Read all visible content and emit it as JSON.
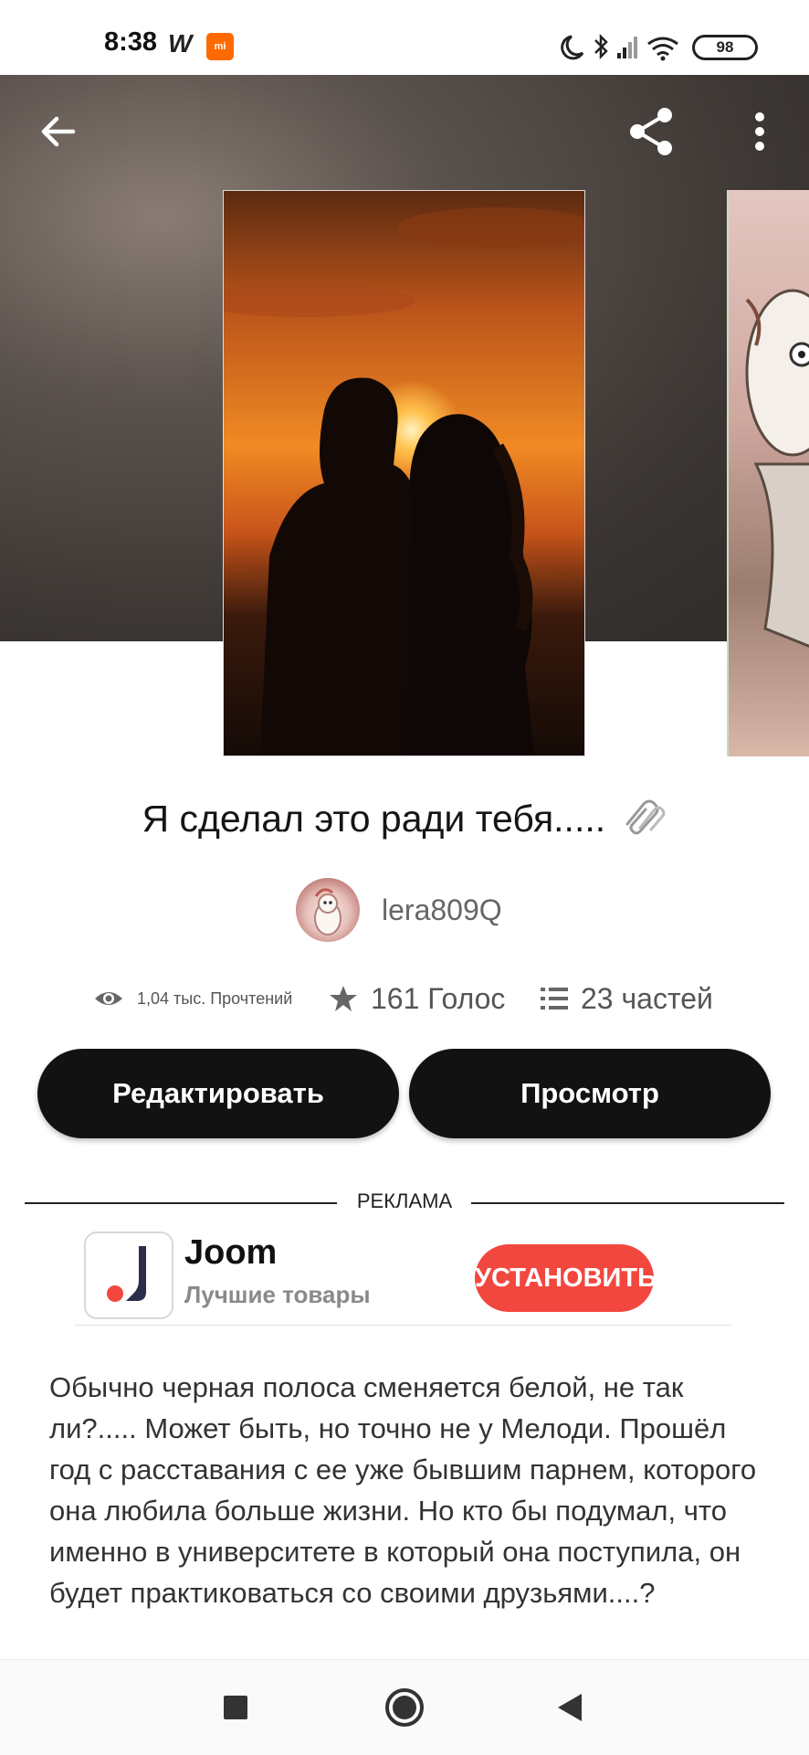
{
  "status_bar": {
    "time": "8:38",
    "app_badge": "W",
    "mi_badge": "mi",
    "battery": "98"
  },
  "story": {
    "title": "Я сделал это ради тебя.....",
    "author": "lera809Q",
    "reads": "1,04 тыс. Прочтений",
    "votes": "161 Голос",
    "parts": "23 частей"
  },
  "actions": {
    "edit_label": "Редактировать",
    "view_label": "Просмотр"
  },
  "ad": {
    "label": "РЕКЛАМА",
    "app_name": "Joom",
    "app_tagline": "Лучшие товары",
    "install_label": "УСТАНОВИТЬ",
    "accent_color": "#f2473f"
  },
  "description": "Обычно черная полоса сменяется белой, не так ли?..... Может быть, но точно не у Мелоди. Прошёл год с расставания с ее уже бывшим парнем, которого она любила больше жизни. Но кто бы подумал, что именно в университете в который она поступила, он будет практиковаться со своими друзьями....?",
  "icons": {
    "back": "arrow-left-icon",
    "share": "share-icon",
    "more": "more-vertical-icon",
    "reads": "eye-icon",
    "votes": "star-icon",
    "parts": "list-icon"
  }
}
